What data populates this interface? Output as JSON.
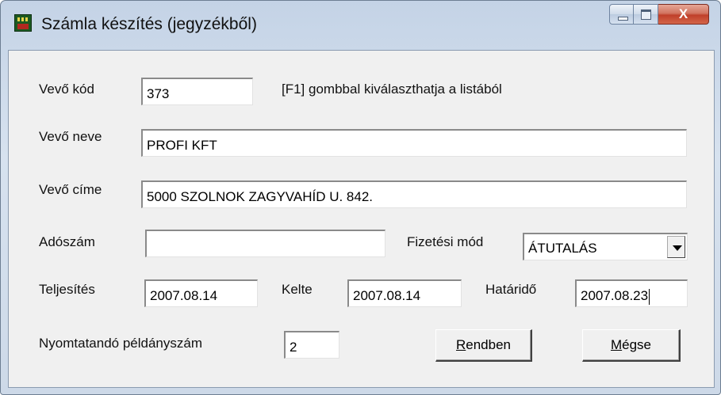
{
  "window": {
    "title": "Számla készítés (jegyzékből)",
    "close_label": "X",
    "icon": "app-icon"
  },
  "form": {
    "vevo_kod": {
      "label": "Vevő kód",
      "value": "373",
      "hint": "[F1] gombbal kiválaszthatja a listából"
    },
    "vevo_neve": {
      "label": "Vevő neve",
      "value": "PROFI  KFT"
    },
    "vevo_cime": {
      "label": "Vevő címe",
      "value": "5000 SZOLNOK ZAGYVAHÍD U. 842."
    },
    "adoszam": {
      "label": "Adószám",
      "value": ""
    },
    "fizetesi_mod": {
      "label": "Fizetési mód",
      "value": "ÁTUTALÁS"
    },
    "teljesites": {
      "label": "Teljesítés",
      "value": "2007.08.14"
    },
    "kelte": {
      "label": "Kelte",
      "value": "2007.08.14"
    },
    "hatarido": {
      "label": "Határidő",
      "value": "2007.08.23"
    },
    "peldanyszam": {
      "label": "Nyomtatandó példányszám",
      "value": "2"
    }
  },
  "buttons": {
    "ok_accel": "R",
    "ok_rest": "endben",
    "cancel_accel": "M",
    "cancel_rest": "égse"
  }
}
